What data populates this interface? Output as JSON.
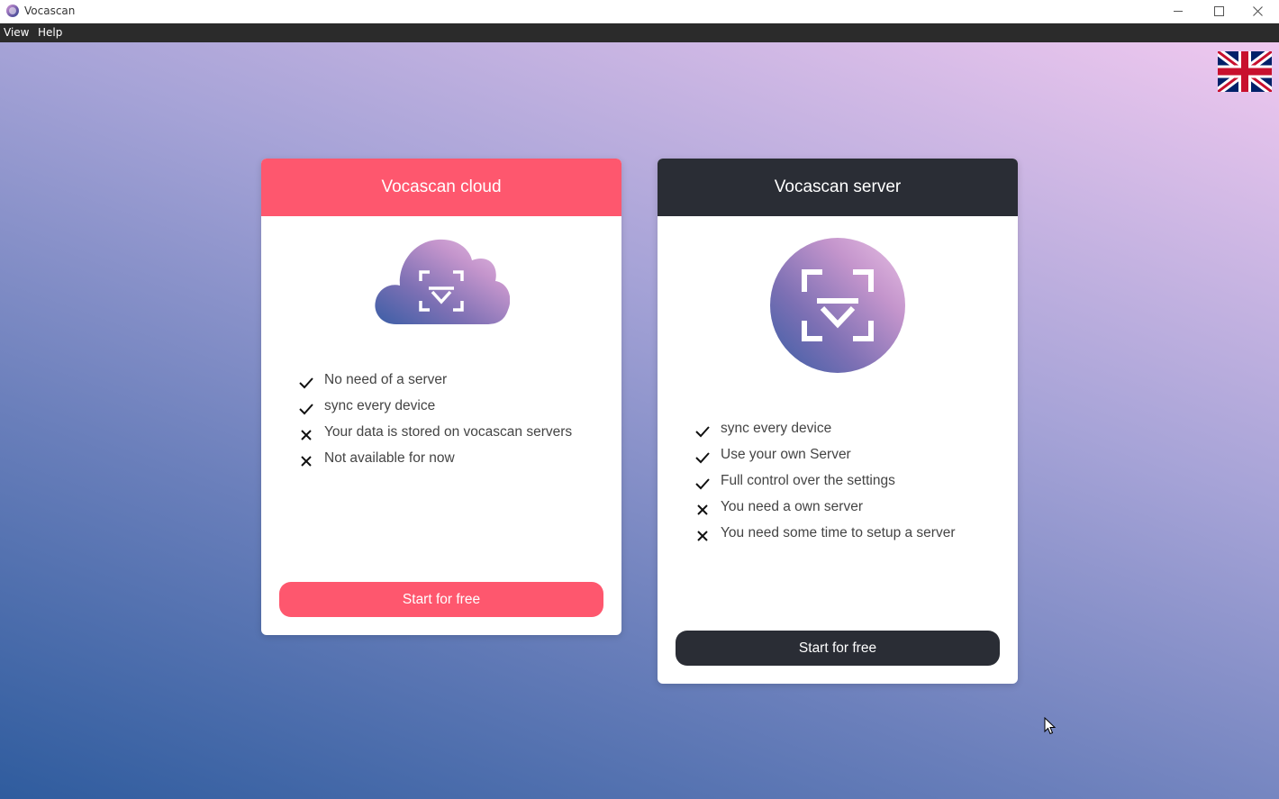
{
  "window": {
    "title": "Vocascan",
    "controls": [
      "minimize-icon",
      "maximize-icon",
      "close-icon"
    ]
  },
  "menu": {
    "view": "View",
    "help": "Help"
  },
  "language": {
    "icon": "uk-flag-icon"
  },
  "cards": {
    "cloud": {
      "title": "Vocascan cloud",
      "image": "cloud-logo-icon",
      "features": [
        {
          "ok": true,
          "text": "No need of a server"
        },
        {
          "ok": true,
          "text": "sync every device"
        },
        {
          "ok": false,
          "text": "Your data is stored on vocascan servers"
        },
        {
          "ok": false,
          "text": "Not available for now"
        }
      ],
      "button": "Start for free",
      "accent": "#fe576e"
    },
    "server": {
      "title": "Vocascan server",
      "image": "server-logo-icon",
      "features": [
        {
          "ok": true,
          "text": "sync every device"
        },
        {
          "ok": true,
          "text": "Use your own Server"
        },
        {
          "ok": true,
          "text": "Full control over the settings"
        },
        {
          "ok": false,
          "text": "You need a own server"
        },
        {
          "ok": false,
          "text": "You need some time to setup a server"
        }
      ],
      "button": "Start for free",
      "accent": "#2a2d35"
    }
  }
}
